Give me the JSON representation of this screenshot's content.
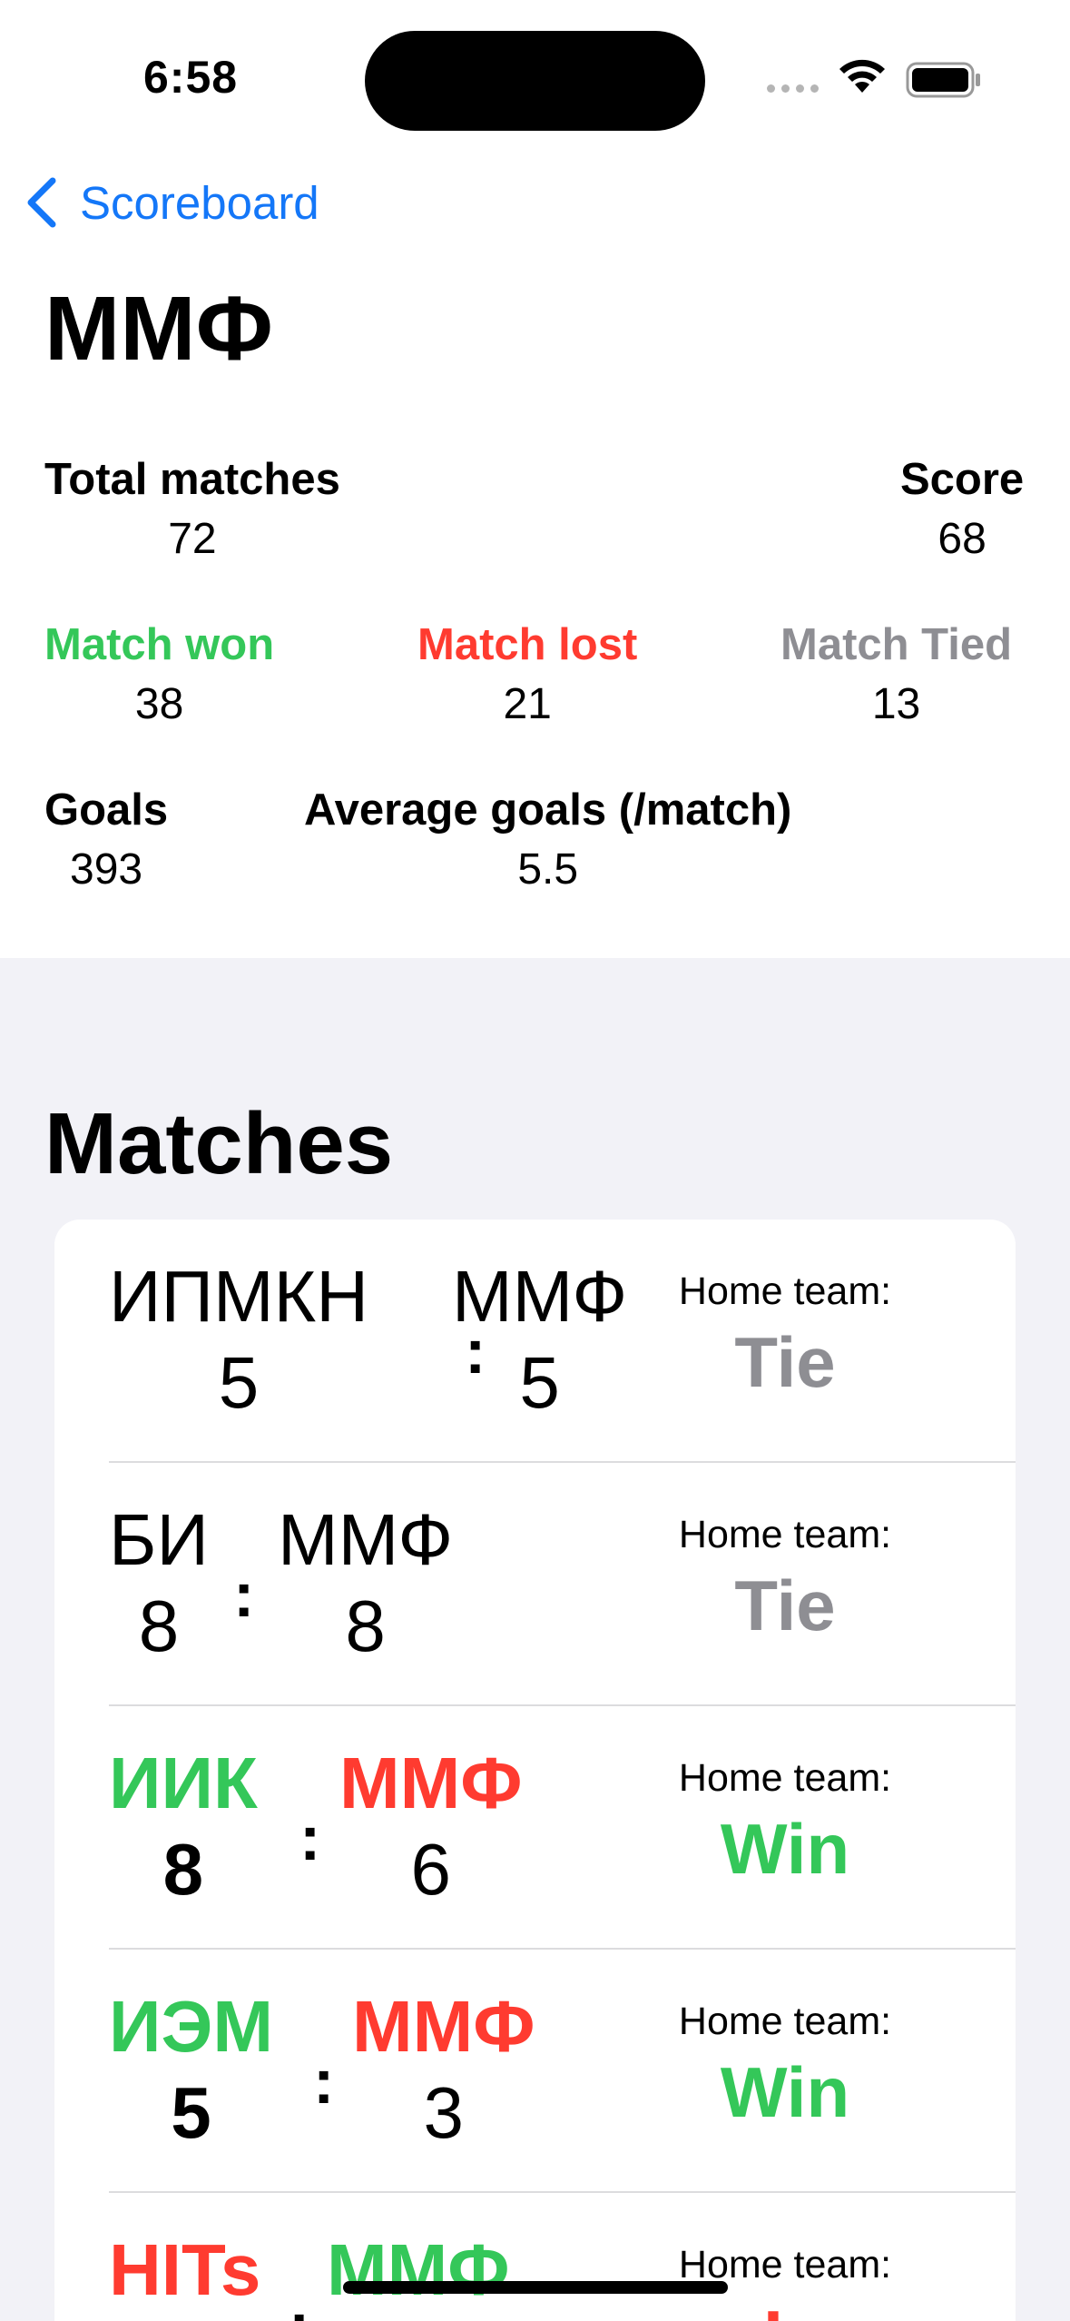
{
  "status_bar": {
    "time": "6:58"
  },
  "nav": {
    "back_label": "Scoreboard"
  },
  "team": {
    "name": "ММФ"
  },
  "stats": {
    "total_matches_label": "Total matches",
    "total_matches": "72",
    "score_label": "Score",
    "score": "68",
    "won_label": "Match won",
    "won": "38",
    "lost_label": "Match lost",
    "lost": "21",
    "tied_label": "Match Tied",
    "tied": "13",
    "goals_label": "Goals",
    "goals": "393",
    "avg_label": "Average goals (/match)",
    "avg": "5.5"
  },
  "matches_title": "Matches",
  "colors": {
    "win": "#34c759",
    "loss": "#ff3b30",
    "tie": "#8e8e93",
    "accent": "#1477f8"
  },
  "matches": [
    {
      "home": "ИПМКН",
      "home_score": "5",
      "away": "ММФ",
      "away_score": "5",
      "home_label": "Home team:",
      "result": "Tie"
    },
    {
      "home": "БИ",
      "home_score": "8",
      "away": "ММФ",
      "away_score": "8",
      "home_label": "Home team:",
      "result": "Tie"
    },
    {
      "home": "ИИК",
      "home_score": "8",
      "away": "ММФ",
      "away_score": "6",
      "home_label": "Home team:",
      "result": "Win"
    },
    {
      "home": "ИЭМ",
      "home_score": "5",
      "away": "ММФ",
      "away_score": "3",
      "home_label": "Home team:",
      "result": "Win"
    },
    {
      "home": "HITs",
      "home_score": "",
      "away": "ММФ",
      "away_score": "",
      "home_label": "Home team:",
      "result": "L"
    }
  ]
}
